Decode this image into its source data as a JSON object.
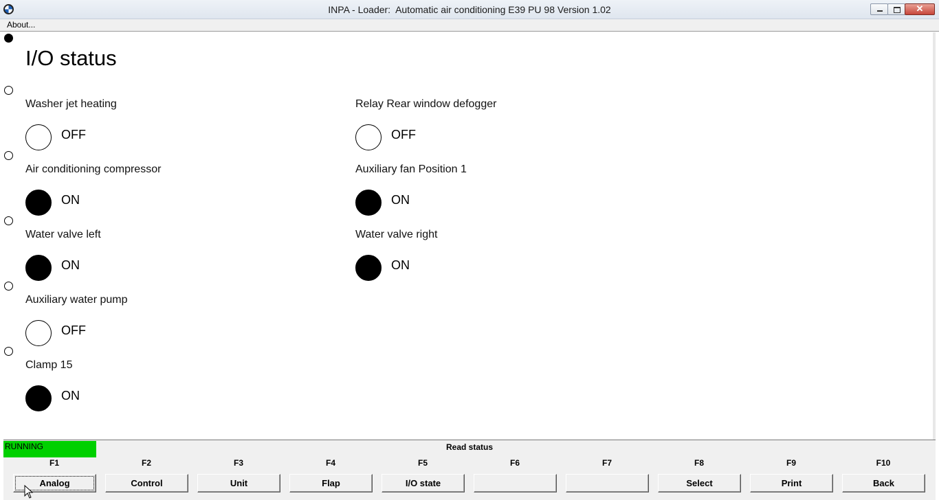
{
  "window": {
    "title": "INPA - Loader:  Automatic air conditioning E39 PU 98 Version 1.02"
  },
  "menu": {
    "about": "About..."
  },
  "page": {
    "title": "I/O status"
  },
  "io": [
    {
      "label": "Washer jet heating",
      "state": "OFF"
    },
    {
      "label": "Relay Rear window defogger",
      "state": "OFF"
    },
    {
      "label": "Air conditioning compressor",
      "state": "ON"
    },
    {
      "label": "Auxiliary fan Position 1",
      "state": "ON"
    },
    {
      "label": "Water valve left",
      "state": "ON"
    },
    {
      "label": "Water valve right",
      "state": "ON"
    },
    {
      "label": "Auxiliary water pump",
      "state": "OFF"
    },
    {
      "label": "Clamp 15",
      "state": "ON"
    }
  ],
  "status": {
    "running": "RUNNING",
    "text": "Read status"
  },
  "fkeys": [
    {
      "key": "F1",
      "label": "Analog"
    },
    {
      "key": "F2",
      "label": "Control"
    },
    {
      "key": "F3",
      "label": "Unit"
    },
    {
      "key": "F4",
      "label": "Flap"
    },
    {
      "key": "F5",
      "label": "I/O state"
    },
    {
      "key": "F6",
      "label": ""
    },
    {
      "key": "F7",
      "label": ""
    },
    {
      "key": "F8",
      "label": "Select"
    },
    {
      "key": "F9",
      "label": "Print"
    },
    {
      "key": "F10",
      "label": "Back"
    }
  ],
  "colors": {
    "running": "#00d000",
    "lamp_on": "#000000",
    "lamp_off": "#ffffff"
  }
}
